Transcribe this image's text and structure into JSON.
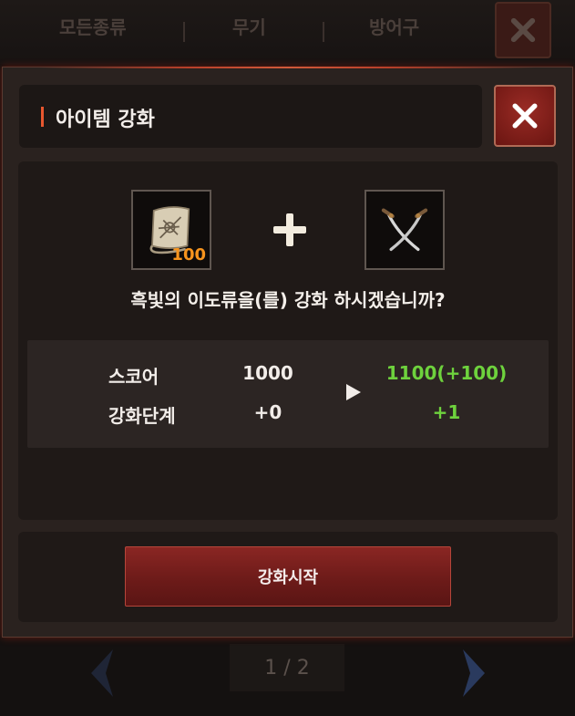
{
  "background": {
    "tabs": [
      "모든종류",
      "무기",
      "방어구"
    ],
    "pager": "1 / 2"
  },
  "dialog": {
    "title": "아이템 강화",
    "material_item": {
      "icon": "scroll-icon",
      "count": "100"
    },
    "target_item": {
      "icon": "dual-swords-icon"
    },
    "confirm_text": "흑빛의 이도류을(를) 강화 하시겠습니까?",
    "stats": [
      {
        "label": "스코어",
        "current": "1000",
        "next": "1100(+100)"
      },
      {
        "label": "강화단계",
        "current": "+0",
        "next": "+1"
      }
    ],
    "start_label": "강화시작"
  },
  "colors": {
    "accent": "#e8572f",
    "count": "#f7941d",
    "increase": "#6ed23d",
    "button": "#7a201e"
  }
}
